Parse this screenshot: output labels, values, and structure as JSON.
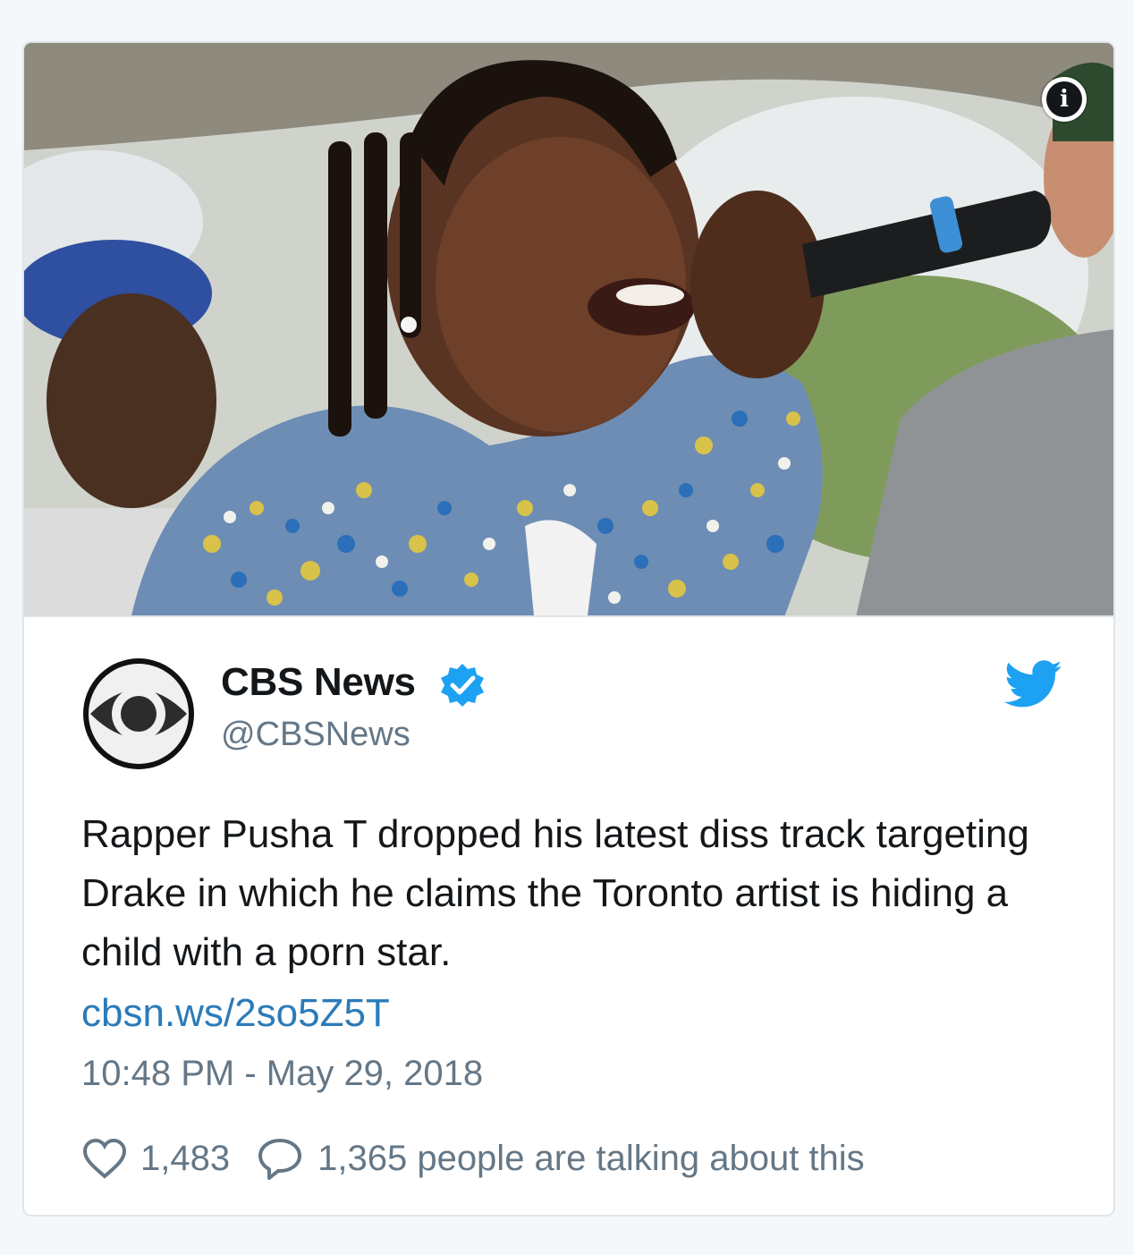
{
  "card": {
    "author": {
      "name": "CBS News",
      "handle": "@CBSNews",
      "verified": true
    },
    "text": "Rapper Pusha T dropped his latest diss track targeting Drake in which he claims the Toronto artist is hiding a child with a porn star.",
    "link": "cbsn.ws/2so5Z5T",
    "timestamp": "10:48 PM - May 29, 2018",
    "stats": {
      "likes": "1,483",
      "talking": "1,365 people are talking about this"
    },
    "icons": {
      "info": "info-icon",
      "verified": "verified-badge-icon",
      "twitter": "twitter-bird-icon",
      "like": "heart-icon",
      "reply": "reply-bubble-icon"
    }
  },
  "colors": {
    "text": "#14171a",
    "secondary": "#657786",
    "link": "#2b7bb9",
    "twitter_blue": "#1da1f2",
    "card_border": "#dfe5ea",
    "page_bg": "#f5f8fa"
  }
}
